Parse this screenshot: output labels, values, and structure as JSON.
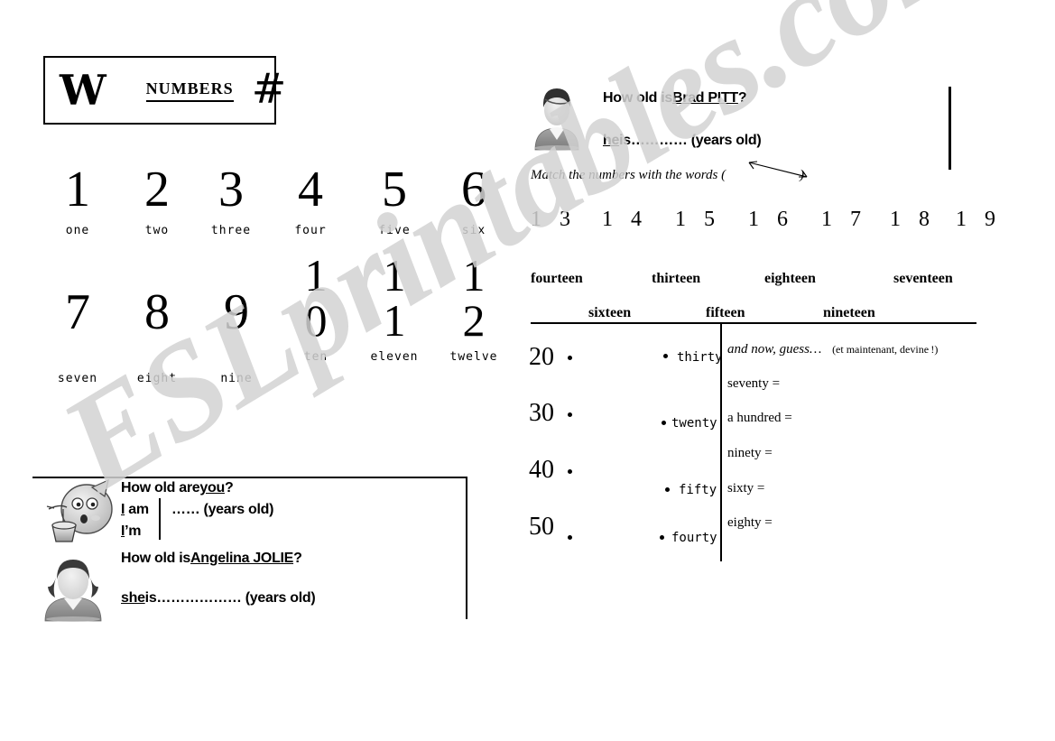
{
  "title_box": {
    "letter": "W",
    "heading": "NUMBERS",
    "symbol": "#"
  },
  "numbers_grid": {
    "row1": [
      {
        "digit": "1",
        "word": "one"
      },
      {
        "digit": "2",
        "word": "two"
      },
      {
        "digit": "3",
        "word": "three"
      },
      {
        "digit": "4",
        "word": "four"
      },
      {
        "digit": "5",
        "word": "five"
      },
      {
        "digit": "6",
        "word": "six"
      }
    ],
    "row2": [
      {
        "digit": "7",
        "word": "seven"
      },
      {
        "digit": "8",
        "word": "eight"
      },
      {
        "digit": "9",
        "word": "nine"
      },
      {
        "digit_top": "1",
        "digit_bottom": "0",
        "word": "ten"
      },
      {
        "digit_top": "1",
        "digit_bottom": "1",
        "word": "eleven"
      },
      {
        "digit_top": "1",
        "digit_bottom": "2",
        "word": "twelve"
      }
    ]
  },
  "age_box": {
    "q1": {
      "prefix": "How old are ",
      "underlined": "you",
      "suffix": " ?"
    },
    "answer1": {
      "i_underline": "I",
      "am": " am",
      "im_underline": "I",
      "im": "’m",
      "dots": "…… (years old)"
    },
    "q2": {
      "prefix": "How old is ",
      "underlined": "Angelina JOLIE",
      "suffix": " ?"
    },
    "answer2": {
      "pronoun": "she",
      "verb": " is ",
      "dots": "……………… (years old)"
    }
  },
  "brad_section": {
    "question": {
      "prefix": "How old is ",
      "underlined": "Brad PITT",
      "suffix": "?"
    },
    "answer": {
      "pronoun": "he",
      "verb": " is ",
      "dots": "………… (years old)"
    },
    "instruction": "Match the numbers with the words ("
  },
  "teen_numbers": [
    "1 3",
    "1 4",
    "1 5",
    "1 6",
    "1 7",
    "1 8",
    "1 9"
  ],
  "teen_words_row1": [
    "fourteen",
    "thirteen",
    "eighteen",
    "seventeen"
  ],
  "teen_words_row2": [
    "sixteen",
    "fifteen",
    "nineteen"
  ],
  "matching": {
    "numbers": [
      "20",
      "30",
      "40",
      "50"
    ],
    "words": [
      "thirty",
      "twenty",
      "fifty",
      "fourty"
    ]
  },
  "guess_panel": {
    "heading_italic": "and now, guess…",
    "heading_french": "(et maintenant, devine !)",
    "items": [
      "seventy =",
      "a hundred =",
      "ninety =",
      "sixty =",
      "eighty ="
    ]
  },
  "watermark": {
    "text": "ESLprintables.com"
  },
  "colors": {
    "ink": "#000000",
    "paper": "#ffffff",
    "watermark": "#d3d3d3",
    "avatar_hair": "#3a3a3a",
    "avatar_face": "#e8e8e8",
    "avatar_body": "#8f8f8f"
  }
}
